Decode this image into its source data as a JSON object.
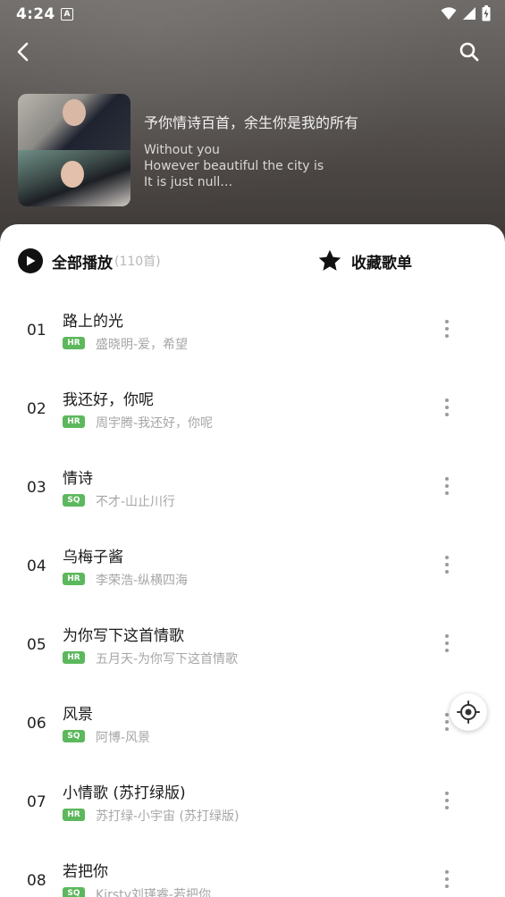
{
  "status_bar": {
    "time": "4:24",
    "a_icon": "A"
  },
  "header": {
    "title": "予你情诗百首，余生你是我的所有",
    "description_lines": [
      "Without you",
      "However beautiful the city is",
      "It is just null…"
    ]
  },
  "actions": {
    "play_all_label": "全部播放",
    "play_count": "(110首)",
    "collect_label": "收藏歌单"
  },
  "songs": [
    {
      "index": "01",
      "title": "路上的光",
      "quality": "HR",
      "subtitle": "盛晓明-爱，希望"
    },
    {
      "index": "02",
      "title": "我还好，你呢",
      "quality": "HR",
      "subtitle": "周宇腾-我还好，你呢"
    },
    {
      "index": "03",
      "title": "情诗",
      "quality": "SQ",
      "subtitle": "不才-山止川行"
    },
    {
      "index": "04",
      "title": "乌梅子酱",
      "quality": "HR",
      "subtitle": "李荣浩-纵横四海"
    },
    {
      "index": "05",
      "title": "为你写下这首情歌",
      "quality": "HR",
      "subtitle": "五月天-为你写下这首情歌"
    },
    {
      "index": "06",
      "title": "风景",
      "quality": "SQ",
      "subtitle": "阿博-风景"
    },
    {
      "index": "07",
      "title": "小情歌 (苏打绿版)",
      "quality": "HR",
      "subtitle": "苏打绿-小宇宙 (苏打绿版)"
    },
    {
      "index": "08",
      "title": "若把你",
      "quality": "SQ",
      "subtitle": "Kirsty刘瑾睿-若把你"
    }
  ],
  "icons": {
    "back": "chevron-left-icon",
    "search": "search-icon",
    "play": "play-icon",
    "star": "star-icon",
    "more": "more-vertical-icon",
    "locate": "locate-icon"
  },
  "colors": {
    "quality_badge": "#5cb85c",
    "accent_black": "#111111"
  }
}
